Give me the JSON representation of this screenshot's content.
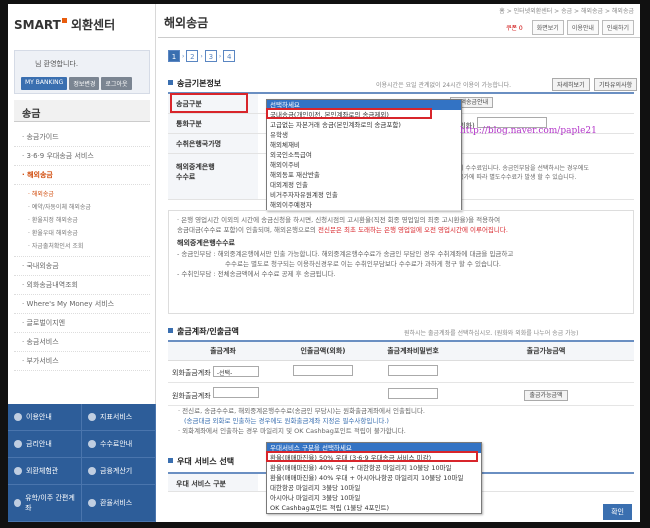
{
  "sidebar": {
    "logo_text": "SMART",
    "logo_suffix": "외환센터",
    "greeting": "님 환영합니다.",
    "greet_buttons": [
      "MY BANKING",
      "정보변경",
      "로그아웃"
    ],
    "menu_title": "송금",
    "items": [
      "송금가이드",
      "3·6·9 우대송금 서비스",
      "해외송금"
    ],
    "submenu": [
      "해외송금",
      "예약/자동이체 해외송금",
      "환율지정 해외송금",
      "환율우대 해외송금",
      "자금출처확인서 조회"
    ],
    "items2": [
      "국내외송금",
      "외화송금내역조회",
      "Where's My Money 서비스",
      "글로벌이지엔",
      "송금서비스",
      "부가서비스"
    ],
    "bottom_nav": [
      "이용안내",
      "지표서비스",
      "금리안내",
      "수수료안내",
      "외환체험관",
      "금융계산기",
      "유학/이주 간편계좌",
      "환율서비스"
    ]
  },
  "header": {
    "title": "해외송금",
    "breadcrumb": "홈 > 인터넷외환센터 > 송금 > 해외송금 > 해외송금",
    "coupon": "쿠폰 0",
    "buttons": [
      "화면보기",
      "이용안내",
      "인쇄하기"
    ]
  },
  "steps": [
    "1",
    "2",
    "3",
    "4"
  ],
  "section1": {
    "title": "송금기본정보",
    "note": "이용시간은 요일 관계없이 24시간 이용이 가능합니다.",
    "btn1": "자세히보기",
    "btn2": "기타유의사항",
    "rows": [
      {
        "label": "송금구분"
      },
      {
        "label": "통화구분"
      },
      {
        "label": "수취은행국가명"
      },
      {
        "label": "해외중계은행\n수수료"
      }
    ],
    "extra_btn": "소액송금안내",
    "amount_label": "액(외화)"
  },
  "dropdown1": {
    "options": [
      "선택하세요",
      "국내송금(개인이전, 본인계좌로의 송금제외)",
      "고급없는 자본거래 송금(본인계좌로의 송금포함)",
      "유학생",
      "해외체재비",
      "외국인소득급여",
      "해외이주비",
      "해외동포 재산반출",
      "대외계정 인출",
      "비거주자자유원계정 인출",
      "해외이주예정자"
    ]
  },
  "watermark": "http://blog.naver.com/paple21",
  "side_text": {
    "line1": "이 수수료입니다. 송금인부담을 선택하시는 경우에도",
    "line2": "국가에 따라 별도수수료가 발생 할 수 있습니다."
  },
  "info": {
    "line1": "· 은행 영업시간 이외의 시간에 송금신청을 하시면, 신청시점의 고시환율(직전 회종 영업일의 최종 고시환율)을 적용하여",
    "line2a": "송금대금(수수료 포함)이 인출되며, 해외은행으로의 ",
    "line2b": "전신문은 최초 도래하는 은행 영업일에 오전 영업시간에 이루어집니다.",
    "sub": "해외중계은행수수료",
    "line3": "- 송금인부담 : 해외중계은행에서만 인출 가능합니다. 해외중계은행수수료가 송금인 부담인 경우 수취계좌에 대금을 입금하고",
    "line4": "수수료는 별도로 청구되는 이용하신경우로 이는 수취인부담보다 수수료가 과하게 청구 할 수 있습니다.",
    "line5": "- 수취인부담 : 전체송금액에서 수수료 공제 후 송금됩니다."
  },
  "section2": {
    "title": "출금계좌/인출금액",
    "note": "원하시는 출금계좌를 선택하십시오. (원화와 외화를 나누어 송금 가능)",
    "headers": [
      "출금계좌",
      "인출금액(외화)",
      "출금계좌비밀번호",
      "출금가능금액"
    ],
    "row1_label": "외화출금계좌",
    "row1_select": "-선택-",
    "row2_label": "원화출금계좌",
    "check_btn": "출금가능금액"
  },
  "notes": [
    "· 전신료, 송금수수료, 해외중계은행수수료(송금인 부담시)는 원화출금계좌에서 인출됩니다.",
    "(송금대금 외화로 인출하는 경우에도 원화출금계좌 지정은 필수사항입니다.)",
    "· 외화계좌에서 인출하는 경우 마일리지 및 OK Cashbag포인트 적립이 불가합니다."
  ],
  "section3": {
    "title": "우대 서비스 선택",
    "row_label": "우대 서비스 구분"
  },
  "dropdown2": {
    "options": [
      "우대서비스 구분을 선택하세요",
      "환율(매매마진율) 50% 우대 (3·6·9 우대송금 서비스 미감)",
      "환율(매매마진율) 40% 우대 + 대한항공 마일리지 10불당 10마일",
      "환율(매매마진율) 40% 우대 + 아시아나항공 마일리지 10불당 10마일",
      "대한항공 마일리지 3불당 10마일",
      "아시아나 마일리지 3불당 10마일",
      "OK Cashbag포인트 적립 (1불당 4포인트)"
    ]
  },
  "ok_button": "확인"
}
